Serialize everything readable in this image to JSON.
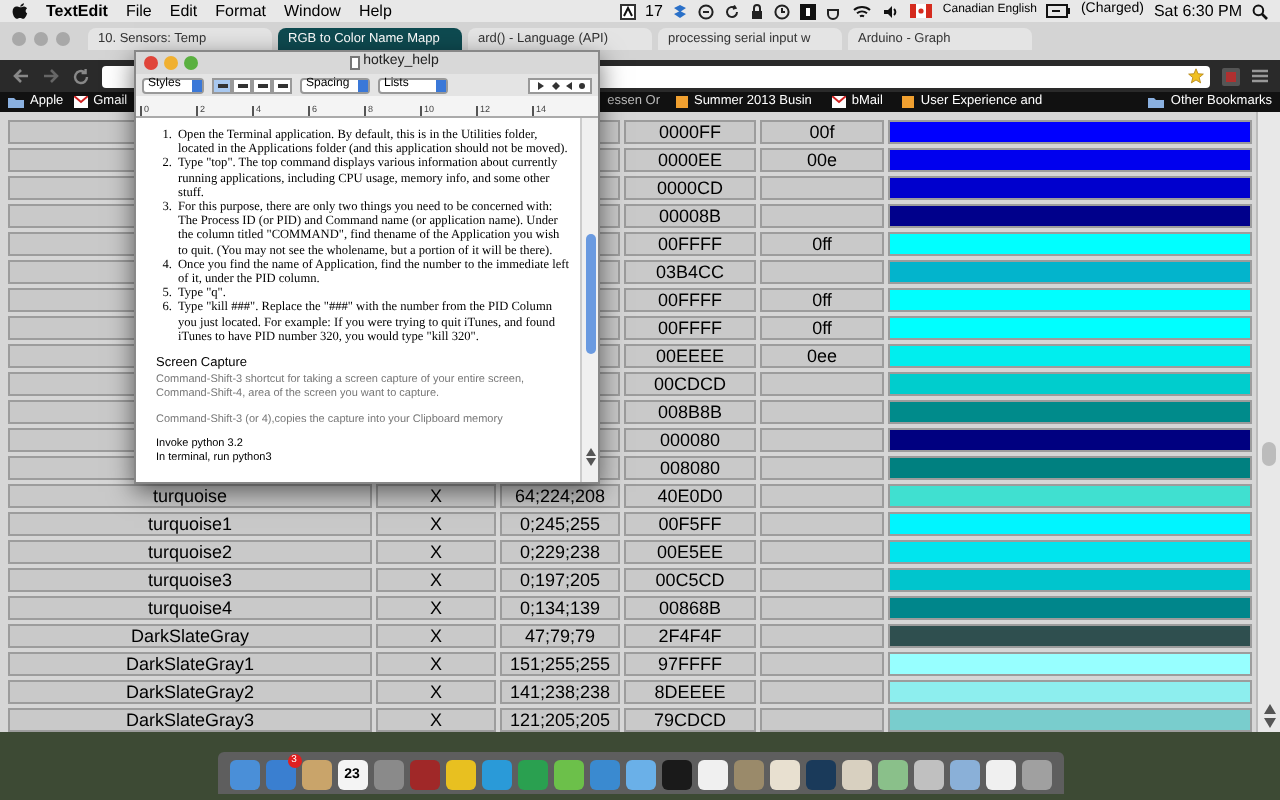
{
  "menu_bar": {
    "app": "TextEdit",
    "items": [
      "File",
      "Edit",
      "Format",
      "Window",
      "Help"
    ],
    "status_count": "17",
    "language": "Canadian English",
    "battery": "(Charged)",
    "clock": "Sat 6:30 PM"
  },
  "browser": {
    "tabs": [
      {
        "label": "10. Sensors: Temp",
        "selected": false
      },
      {
        "label": "RGB to Color Name Mapp",
        "selected": true
      },
      {
        "label": "ard() - Language (API)",
        "selected": false
      },
      {
        "label": "processing serial input w",
        "selected": false
      },
      {
        "label": "Arduino - Graph",
        "selected": false
      }
    ],
    "bookmarks": [
      {
        "label": "Apple",
        "kind": "folder"
      },
      {
        "label": "Gmail",
        "kind": "mail"
      },
      {
        "label": "essen Or",
        "kind": "plain"
      },
      {
        "label": "Summer 2013 Busin",
        "kind": "page"
      },
      {
        "label": "bMail",
        "kind": "mail"
      },
      {
        "label": "User Experience and",
        "kind": "page"
      },
      {
        "label": "Other Bookmarks",
        "kind": "folder"
      }
    ],
    "table": {
      "rows": [
        {
          "hex": "0000FF",
          "short": "00f",
          "color": "#0000ff"
        },
        {
          "hex": "0000EE",
          "short": "00e",
          "color": "#0000ee"
        },
        {
          "hex": "0000CD",
          "color": "#0000cd"
        },
        {
          "hex": "00008B",
          "color": "#00008b"
        },
        {
          "hex": "00FFFF",
          "short": "0ff",
          "color": "#00ffff"
        },
        {
          "hex": "03B4CC",
          "color": "#03b4cc"
        },
        {
          "hex": "00FFFF",
          "short": "0ff",
          "color": "#00ffff"
        },
        {
          "hex": "00FFFF",
          "short": "0ff",
          "color": "#00ffff"
        },
        {
          "hex": "00EEEE",
          "short": "0ee",
          "color": "#00eeee"
        },
        {
          "hex": "00CDCD",
          "color": "#00cdcd"
        },
        {
          "hex": "008B8B",
          "color": "#008b8b"
        },
        {
          "hex": "000080",
          "color": "#000080"
        },
        {
          "hex": "008080",
          "color": "#008080"
        },
        {
          "name": "turquoise",
          "x": "X",
          "rgb": "64;224;208",
          "hex": "40E0D0",
          "color": "#40e0d0"
        },
        {
          "name": "turquoise1",
          "x": "X",
          "rgb": "0;245;255",
          "hex": "00F5FF",
          "color": "#00f5ff"
        },
        {
          "name": "turquoise2",
          "x": "X",
          "rgb": "0;229;238",
          "hex": "00E5EE",
          "color": "#00e5ee"
        },
        {
          "name": "turquoise3",
          "x": "X",
          "rgb": "0;197;205",
          "hex": "00C5CD",
          "color": "#00c5cd"
        },
        {
          "name": "turquoise4",
          "x": "X",
          "rgb": "0;134;139",
          "hex": "00868B",
          "color": "#00868b"
        },
        {
          "name": "DarkSlateGray",
          "x": "X",
          "rgb": "47;79;79",
          "hex": "2F4F4F",
          "color": "#2f4f4f"
        },
        {
          "name": "DarkSlateGray1",
          "x": "X",
          "rgb": "151;255;255",
          "hex": "97FFFF",
          "color": "#97ffff"
        },
        {
          "name": "DarkSlateGray2",
          "x": "X",
          "rgb": "141;238;238",
          "hex": "8DEEEE",
          "color": "#8deeee"
        },
        {
          "name": "DarkSlateGray3",
          "x": "X",
          "rgb": "121;205;205",
          "hex": "79CDCD",
          "color": "#79cdcd"
        }
      ]
    }
  },
  "textedit": {
    "title": "hotkey_help",
    "toolbar": {
      "styles": "Styles",
      "spacing": "Spacing",
      "lists": "Lists",
      "alignments": [
        {
          "selected": true
        },
        {
          "selected": false
        },
        {
          "selected": false
        },
        {
          "selected": false
        }
      ]
    },
    "ruler": [
      "0",
      "2",
      "4",
      "6",
      "8",
      "10",
      "12",
      "14"
    ],
    "steps": [
      {
        "number": "1.",
        "text": "Open the Terminal application. By default, this is in the Utilities folder, located in the Applications folder (and this application should not be moved)."
      },
      {
        "number": "2.",
        "text": "Type \"top\". The top command displays various information about currently running applications, including CPU usage, memory info, and some other stuff."
      },
      {
        "number": "3.",
        "text": "For this purpose, there are only two things you need to be concerned with: The Process ID (or PID) and Command name (or application name). Under the column titled \"COMMAND\", find thename of the Application you wish to quit. (You may not see the wholename, but a portion of it will be there)."
      },
      {
        "number": "4.",
        "text": "Once you find the name of Application, find the number to the immediate left of it, under the PID column."
      },
      {
        "number": "5.",
        "text": "Type \"q\"."
      },
      {
        "number": "6.",
        "text": "Type \"kill ###\". Replace the \"###\" with the number from the PID Column you just located. For example: If you were trying to quit iTunes, and found iTunes to have PID number 320, you would type \"kill 320\"."
      }
    ],
    "heading": "Screen Capture",
    "notes": [
      "Command-Shift-3 shortcut for taking a screen capture of your entire screen,",
      "Command-Shift-4,  area of the screen you want to capture.",
      "Command-Shift-3 (or 4),copies the capture into your Clipboard memory"
    ],
    "footer": [
      "Invoke python 3.2",
      "In terminal, run python3"
    ]
  },
  "dock": [
    {
      "color": "#4a8fd8"
    },
    {
      "color": "#3a7fd0",
      "badge": "3"
    },
    {
      "color": "#c9a46a"
    },
    {
      "color": "#f4f4f4",
      "label": "23"
    },
    {
      "color": "#8a8a8a"
    },
    {
      "color": "#a02828"
    },
    {
      "color": "#e8c020"
    },
    {
      "color": "#2a9ad8"
    },
    {
      "color": "#2aa050"
    },
    {
      "color": "#6cc04a"
    },
    {
      "color": "#3a8ad0"
    },
    {
      "color": "#6ab0e8"
    },
    {
      "color": "#1a1a1a"
    },
    {
      "color": "#f0f0f0"
    },
    {
      "color": "#9a8a6a"
    },
    {
      "color": "#e8e0d0"
    },
    {
      "color": "#1a3a5a"
    },
    {
      "color": "#d8d0c0"
    },
    {
      "color": "#8ac08a"
    },
    {
      "color": "#c0c0c0"
    },
    {
      "color": "#8ab0d8"
    },
    {
      "color": "#f0f0f0"
    },
    {
      "color": "#a0a0a0"
    }
  ]
}
